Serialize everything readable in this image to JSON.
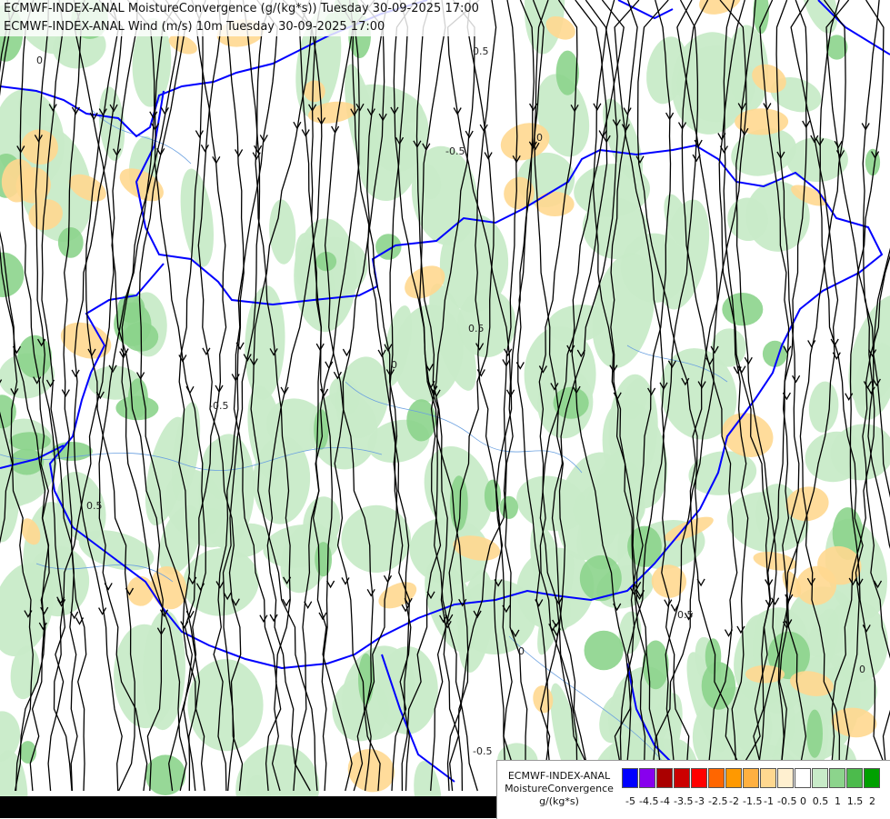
{
  "header": {
    "line1": "ECMWF-INDEX-ANAL MoistureConvergence (g/(kg*s)) Tuesday 30-09-2025 17:00",
    "line2": "ECMWF-INDEX-ANAL Wind (m/s) 10m Tuesday 30-09-2025 17:00"
  },
  "legend": {
    "title_line1": "ECMWF-INDEX-ANAL",
    "title_line2": "MoistureConvergence",
    "unit": "g/(kg*s)",
    "ticks": [
      "-5",
      "-4.5",
      "-4",
      "-3.5",
      "-3",
      "-2.5",
      "-2",
      "-1.5",
      "-1",
      "-0.5",
      "0",
      "0.5",
      "1",
      "1.5",
      "2"
    ],
    "colors": [
      "#0000ff",
      "#8800ee",
      "#aa0000",
      "#cc0000",
      "#ff0000",
      "#ff6600",
      "#ff9900",
      "#ffb040",
      "#ffd890",
      "#fff0d0",
      "#ffffff",
      "#c8ebc8",
      "#8cd48c",
      "#4cbb4c",
      "#00a000"
    ]
  },
  "map_labels": [
    "0",
    "0.5",
    "-0.5",
    "0",
    "0.5",
    "0",
    "-0.5",
    "0.5",
    "0",
    "0.5",
    "0",
    "-0.5"
  ],
  "colors": {
    "border": "#0000ff",
    "streamline": "#000000",
    "convergence_low": "#c8ebc8",
    "convergence_mid": "#8cd48c",
    "divergence": "#ffd890"
  }
}
